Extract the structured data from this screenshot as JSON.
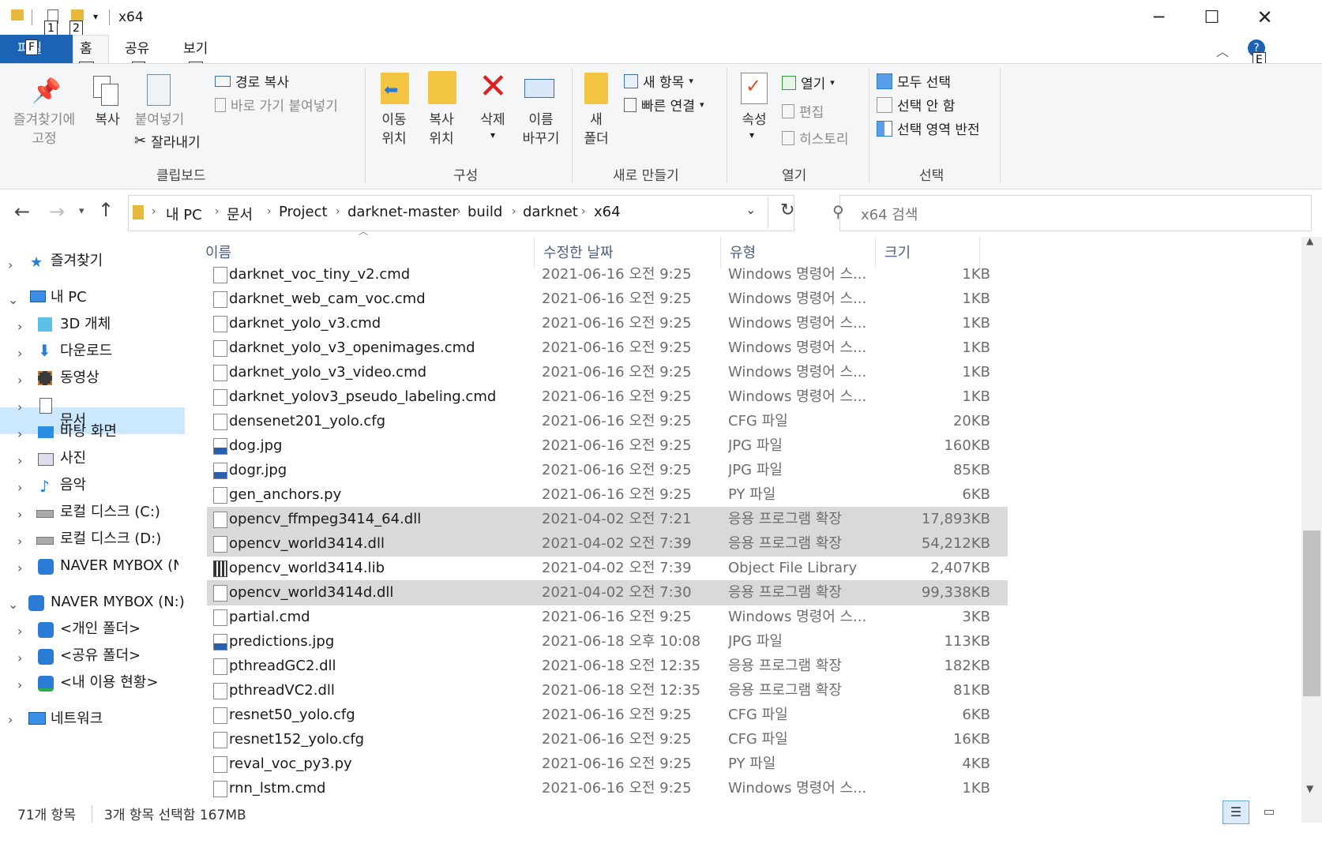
{
  "window": {
    "title": "x64",
    "keytips": {
      "file": "F",
      "qat1": "1",
      "qat2": "2",
      "home": "H",
      "share": "S",
      "view": "V",
      "help": "E"
    }
  },
  "ribbon": {
    "tabs": {
      "file": "파일",
      "home": "홈",
      "share": "공유",
      "view": "보기"
    },
    "clipboard": {
      "pin_label": "즐겨찾기에\n고정",
      "copy_label": "복사",
      "paste_label": "붙여넣기",
      "copy_path": "경로 복사",
      "paste_shortcut": "바로 가기 붙여넣기",
      "cut": "잘라내기",
      "group": "클립보드"
    },
    "organize": {
      "move_to": "이동\n위치",
      "copy_to": "복사\n위치",
      "delete": "삭제",
      "rename": "이름\n바꾸기",
      "group": "구성"
    },
    "new": {
      "new_folder": "새\n폴더",
      "new_item": "새 항목",
      "easy_access": "빠른 연결",
      "group": "새로 만들기"
    },
    "open": {
      "properties": "속성",
      "open": "열기",
      "edit": "편집",
      "history": "히스토리",
      "group": "열기"
    },
    "select": {
      "select_all": "모두 선택",
      "select_none": "선택 안 함",
      "invert": "선택 영역 반전",
      "group": "선택"
    }
  },
  "address": {
    "crumbs": [
      "내 PC",
      "문서",
      "Project",
      "darknet-master",
      "build",
      "darknet",
      "x64"
    ],
    "search_placeholder": "x64 검색"
  },
  "nav": {
    "favorites": "즐겨찾기",
    "this_pc": "내 PC",
    "objects3d": "3D 개체",
    "downloads": "다운로드",
    "videos": "동영상",
    "documents": "문서",
    "desktop": "바탕 화면",
    "pictures": "사진",
    "music": "음악",
    "local_c": "로컬 디스크 (C:)",
    "local_d": "로컬 디스크 (D:)",
    "mybox_sub": "NAVER MYBOX (N:)",
    "mybox": "NAVER MYBOX (N:)",
    "personal": "<개인 폴더>",
    "shared": "<공유 폴더>",
    "usage": "<내 이용 현황>",
    "network": "네트워크"
  },
  "columns": {
    "name": "이름",
    "date": "수정한 날짜",
    "type": "유형",
    "size": "크기"
  },
  "files": [
    {
      "name": "darknet_voc_tiny_v2.cmd",
      "date": "2021-06-16 오전 9:25",
      "type": "Windows 명령어 스...",
      "size": "1KB",
      "icon": "cmd"
    },
    {
      "name": "darknet_web_cam_voc.cmd",
      "date": "2021-06-16 오전 9:25",
      "type": "Windows 명령어 스...",
      "size": "1KB",
      "icon": "cmd"
    },
    {
      "name": "darknet_yolo_v3.cmd",
      "date": "2021-06-16 오전 9:25",
      "type": "Windows 명령어 스...",
      "size": "1KB",
      "icon": "cmd"
    },
    {
      "name": "darknet_yolo_v3_openimages.cmd",
      "date": "2021-06-16 오전 9:25",
      "type": "Windows 명령어 스...",
      "size": "1KB",
      "icon": "cmd"
    },
    {
      "name": "darknet_yolo_v3_video.cmd",
      "date": "2021-06-16 오전 9:25",
      "type": "Windows 명령어 스...",
      "size": "1KB",
      "icon": "cmd"
    },
    {
      "name": "darknet_yolov3_pseudo_labeling.cmd",
      "date": "2021-06-16 오전 9:25",
      "type": "Windows 명령어 스...",
      "size": "1KB",
      "icon": "cmd"
    },
    {
      "name": "densenet201_yolo.cfg",
      "date": "2021-06-16 오전 9:25",
      "type": "CFG 파일",
      "size": "20KB",
      "icon": "blank"
    },
    {
      "name": "dog.jpg",
      "date": "2021-06-16 오전 9:25",
      "type": "JPG 파일",
      "size": "160KB",
      "icon": "jpg"
    },
    {
      "name": "dogr.jpg",
      "date": "2021-06-16 오전 9:25",
      "type": "JPG 파일",
      "size": "85KB",
      "icon": "jpg"
    },
    {
      "name": "gen_anchors.py",
      "date": "2021-06-16 오전 9:25",
      "type": "PY 파일",
      "size": "6KB",
      "icon": "blank"
    },
    {
      "name": "opencv_ffmpeg3414_64.dll",
      "date": "2021-04-02 오전 7:21",
      "type": "응용 프로그램 확장",
      "size": "17,893KB",
      "icon": "dll",
      "selected": true
    },
    {
      "name": "opencv_world3414.dll",
      "date": "2021-04-02 오전 7:39",
      "type": "응용 프로그램 확장",
      "size": "54,212KB",
      "icon": "dll",
      "selected": true
    },
    {
      "name": "opencv_world3414.lib",
      "date": "2021-04-02 오전 7:39",
      "type": "Object File Library",
      "size": "2,407KB",
      "icon": "lib"
    },
    {
      "name": "opencv_world3414d.dll",
      "date": "2021-04-02 오전 7:30",
      "type": "응용 프로그램 확장",
      "size": "99,338KB",
      "icon": "dll",
      "selected": true
    },
    {
      "name": "partial.cmd",
      "date": "2021-06-16 오전 9:25",
      "type": "Windows 명령어 스...",
      "size": "3KB",
      "icon": "cmd"
    },
    {
      "name": "predictions.jpg",
      "date": "2021-06-18 오후 10:08",
      "type": "JPG 파일",
      "size": "113KB",
      "icon": "jpg"
    },
    {
      "name": "pthreadGC2.dll",
      "date": "2021-06-18 오전 12:35",
      "type": "응용 프로그램 확장",
      "size": "182KB",
      "icon": "dll"
    },
    {
      "name": "pthreadVC2.dll",
      "date": "2021-06-18 오전 12:35",
      "type": "응용 프로그램 확장",
      "size": "81KB",
      "icon": "dll"
    },
    {
      "name": "resnet50_yolo.cfg",
      "date": "2021-06-16 오전 9:25",
      "type": "CFG 파일",
      "size": "6KB",
      "icon": "blank"
    },
    {
      "name": "resnet152_yolo.cfg",
      "date": "2021-06-16 오전 9:25",
      "type": "CFG 파일",
      "size": "16KB",
      "icon": "blank"
    },
    {
      "name": "reval_voc_py3.py",
      "date": "2021-06-16 오전 9:25",
      "type": "PY 파일",
      "size": "4KB",
      "icon": "blank"
    },
    {
      "name": "rnn_lstm.cmd",
      "date": "2021-06-16 오전 9:25",
      "type": "Windows 명령어 스...",
      "size": "1KB",
      "icon": "cmd"
    }
  ],
  "status": {
    "count": "71개 항목",
    "selection": "3개 항목 선택함 167MB"
  }
}
